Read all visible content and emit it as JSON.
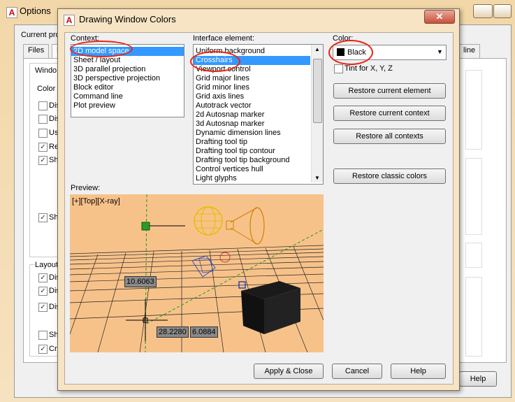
{
  "options_window": {
    "title": "Options",
    "current_profile_label": "Current prof",
    "tabs": [
      "Files",
      "D"
    ],
    "right_tab": "line",
    "window_group_label": "Windo",
    "color_label": "Color s",
    "checkboxes_upper": [
      "Dis",
      "Dis",
      "Us",
      "Re",
      "Sh"
    ],
    "checkbox_sh": "Sh",
    "layout_label": "Layout",
    "checkboxes_lower": [
      "Dis",
      "Dis",
      "Dis",
      "Sh",
      "Cre"
    ],
    "help_label": "Help"
  },
  "dialog": {
    "title": "Drawing Window Colors",
    "close_label": "✕",
    "context": {
      "label": "Context:",
      "items": [
        "2D model space",
        "Sheet / layout",
        "3D parallel projection",
        "3D perspective projection",
        "Block editor",
        "Command line",
        "Plot preview"
      ],
      "selected_index": 0
    },
    "interface_element": {
      "label": "Interface element:",
      "items": [
        "Uniform background",
        "Crosshairs",
        "Viewport control",
        "Grid major lines",
        "Grid minor lines",
        "Grid axis lines",
        "Autotrack vector",
        "2d Autosnap marker",
        "3d Autosnap marker",
        "Dynamic dimension lines",
        "Drafting tool tip",
        "Drafting tool tip contour",
        "Drafting tool tip background",
        "Control vertices hull",
        "Light glyphs"
      ],
      "selected_index": 1
    },
    "color": {
      "label": "Color:",
      "value": "Black",
      "swatch": "#000000"
    },
    "tint_label": "Tint for X, Y, Z",
    "buttons": {
      "restore_element": "Restore current element",
      "restore_context": "Restore current context",
      "restore_all": "Restore all contexts",
      "restore_classic": "Restore classic colors",
      "apply_close": "Apply & Close",
      "cancel": "Cancel",
      "help": "Help"
    },
    "preview": {
      "label": "Preview:",
      "viewport_label": "[+][Top][X-ray]",
      "dim_1": "10.6063",
      "dim_2": "28.2280",
      "dim_3": "6.0884",
      "background": "#f7c28a"
    }
  },
  "annotation_color": "#e21a1a"
}
